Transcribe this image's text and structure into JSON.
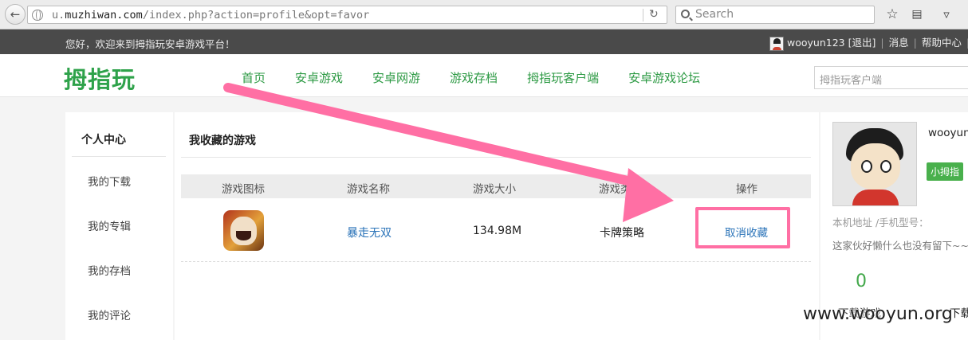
{
  "browser": {
    "url_prefix": "u.",
    "url_domain": "muzhiwan.com",
    "url_path": "/index.php?action=profile&opt=favor",
    "search_placeholder": "Search"
  },
  "topbar": {
    "welcome": "您好，欢迎来到拇指玩安卓游戏平台！",
    "username": "wooyun123",
    "logout": "[退出]",
    "messages": "消息",
    "help": "帮助中心"
  },
  "header": {
    "logo": "拇指玩",
    "nav": [
      "首页",
      "安卓游戏",
      "安卓网游",
      "游戏存档",
      "拇指玩客户端",
      "安卓游戏论坛"
    ],
    "search_placeholder": "拇指玩客户端"
  },
  "sidebar": {
    "title": "个人中心",
    "items": [
      "我的下载",
      "我的专辑",
      "我的存档",
      "我的评论"
    ]
  },
  "main": {
    "title": "我收藏的游戏",
    "columns": [
      "游戏图标",
      "游戏名称",
      "游戏大小",
      "游戏类",
      "操作"
    ],
    "rows": [
      {
        "name": "暴走无双",
        "size": "134.98M",
        "type": "卡牌策略",
        "action": "取消收藏"
      }
    ]
  },
  "profile": {
    "name": "wooyun",
    "badge": "小拇指",
    "address": "本机地址 /手机型号：",
    "bio": "这家伙好懒什么也没有留下~~",
    "stat_value": "0",
    "stat_label": "下载游戏",
    "stat_label2": "下载"
  },
  "overlay": {
    "arrow_color": "#ff6fa4",
    "watermark": "www.wooyun.org"
  }
}
